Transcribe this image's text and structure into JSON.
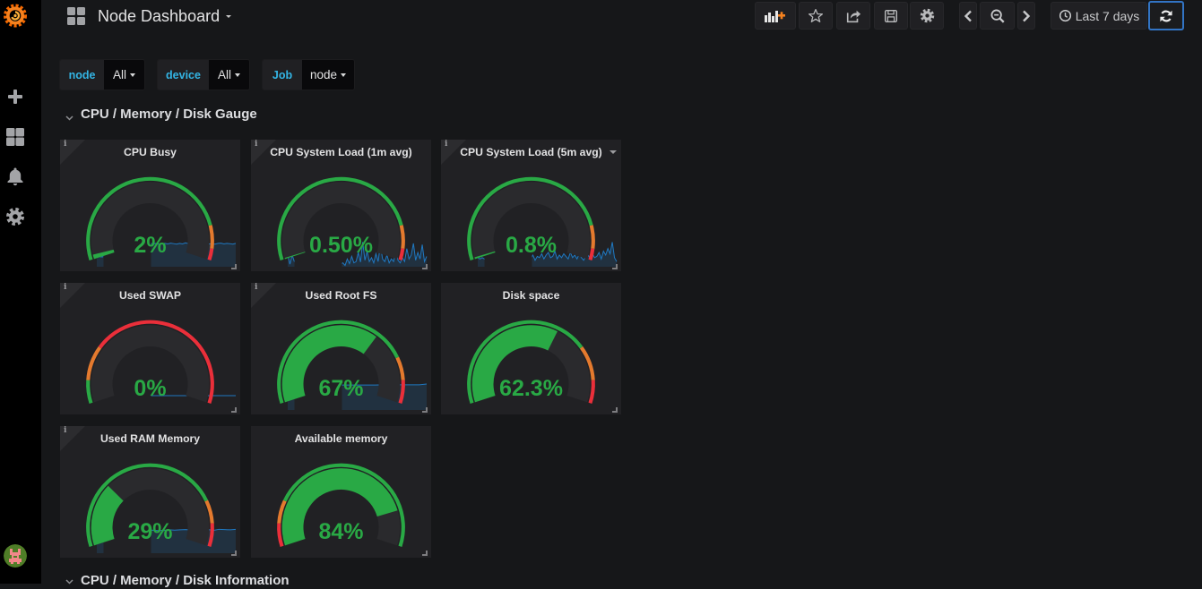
{
  "sidebar": {
    "logo": "grafana-logo",
    "items": [
      {
        "name": "create",
        "icon": "plus-icon"
      },
      {
        "name": "dashboards",
        "icon": "dashboards-icon"
      },
      {
        "name": "alerting",
        "icon": "bell-icon"
      },
      {
        "name": "configuration",
        "icon": "gear-icon"
      }
    ],
    "avatar": "user-avatar"
  },
  "header": {
    "title": "Node Dashboard",
    "icon": "dashboard-grid-icon"
  },
  "toolbar": {
    "buttons": [
      {
        "name": "add-panel",
        "icon": "add-panel-icon"
      },
      {
        "name": "star",
        "icon": "star-icon"
      },
      {
        "name": "share",
        "icon": "share-icon"
      },
      {
        "name": "save",
        "icon": "save-icon"
      },
      {
        "name": "settings",
        "icon": "gear-icon"
      },
      {
        "name": "time-back",
        "icon": "chevron-left-icon"
      },
      {
        "name": "zoom-out",
        "icon": "zoom-out-icon"
      },
      {
        "name": "time-forward",
        "icon": "chevron-right-icon"
      }
    ],
    "time_range": "Last 7 days",
    "refresh_icon": "refresh-icon"
  },
  "variables": [
    {
      "label": "node",
      "value": "All"
    },
    {
      "label": "device",
      "value": "All"
    },
    {
      "label": "Job",
      "value": "node"
    }
  ],
  "rows": [
    {
      "title": "CPU / Memory / Disk Gauge",
      "expanded": true
    },
    {
      "title": "CPU / Memory / Disk Information",
      "expanded": true
    }
  ],
  "icons": {
    "info_glyph": "i"
  },
  "colors": {
    "ok": "#29a945",
    "warn": "#e47a2e",
    "crit": "#ea2f3a",
    "spark_line": "#1f78c1",
    "spark_fill": "rgba(31,120,193,0.18)",
    "gauge_track": "#2a2a2d",
    "panel_bg": "#212124",
    "accent": "#33b5e5",
    "refresh_border": "#3274c4"
  },
  "panels": [
    {
      "title": "CPU Busy",
      "value_text": "2%",
      "value": 0.02,
      "thresholds": [
        0.85,
        0.95
      ],
      "threshold_colors": [
        "ok",
        "warn",
        "crit"
      ],
      "info": true,
      "menu_caret": false,
      "spark": {
        "fill": true,
        "values": [
          0.38,
          0.38,
          0.38,
          0.86,
          0.88,
          0.9,
          0.87,
          0.89,
          0.91,
          0.88,
          0.86,
          0.9,
          0.89,
          0.92,
          0.88,
          0.87,
          0.9,
          0.89,
          0.91,
          0.88,
          0.9,
          0.87,
          0.89,
          0.9,
          0.88,
          0.91,
          0.89,
          0.87,
          0.9,
          0.88,
          0.92,
          0.89,
          0.88,
          0.9,
          0.87,
          0.89,
          0.91,
          0.9,
          0.88,
          0.89,
          0.87,
          0.9,
          0.91,
          0.88,
          0.9,
          0.89,
          0.87,
          0.9
        ]
      }
    },
    {
      "title": "CPU System Load (1m avg)",
      "value_text": "0.50%",
      "value": 0.005,
      "thresholds": [
        0.85,
        0.95
      ],
      "threshold_colors": [
        "ok",
        "warn",
        "crit"
      ],
      "info": true,
      "menu_caret": false,
      "spark": {
        "fill": true,
        "values": [
          0.5,
          0.1,
          0.45,
          0.2,
          0.15,
          0.2,
          0.1,
          0.15,
          0.2,
          0.1,
          0.15,
          0.2,
          0.1,
          0.15,
          0.2,
          0.1,
          0.15,
          0.2,
          0.1,
          0.15,
          0.2,
          0.1,
          0.15,
          0.2,
          0.1,
          0.15,
          0.05,
          0.3,
          0.12,
          0.4,
          0.15,
          0.2,
          0.55,
          0.18,
          0.95,
          0.25,
          0.6,
          0.2,
          0.35,
          0.15,
          0.5,
          0.2,
          0.85,
          0.3,
          0.2,
          0.45,
          0.15,
          0.3,
          0.2,
          0.6,
          0.25,
          0.15,
          0.35,
          0.2,
          0.7,
          0.3,
          0.45,
          0.9,
          0.25,
          0.55,
          0.3,
          0.85,
          0.2,
          0.4
        ]
      }
    },
    {
      "title": "CPU System Load (5m avg)",
      "value_text": "0.8%",
      "value": 0.008,
      "thresholds": [
        0.85,
        0.95
      ],
      "threshold_colors": [
        "ok",
        "warn",
        "crit"
      ],
      "info": true,
      "menu_caret": true,
      "spark": {
        "fill": true,
        "values": [
          0.35,
          0.3,
          0.35,
          0.3,
          0.35,
          0.3,
          0.35,
          0.3,
          0.35,
          0.3,
          0.35,
          0.3,
          0.35,
          0.3,
          0.35,
          0.3,
          0.35,
          0.3,
          0.35,
          0.3,
          0.35,
          0.3,
          0.35,
          0.3,
          0.3,
          0.45,
          0.25,
          0.4,
          0.35,
          0.5,
          0.3,
          0.45,
          0.55,
          0.35,
          0.4,
          0.6,
          0.3,
          0.45,
          0.35,
          0.5,
          0.4,
          0.3,
          0.55,
          0.35,
          0.45,
          0.3,
          0.5,
          0.35,
          0.25,
          0.4,
          0.45,
          0.3,
          0.5,
          0.35,
          0.4,
          0.55,
          0.3,
          0.6,
          0.45,
          0.7,
          0.5,
          0.95,
          0.35,
          0.2
        ]
      }
    },
    {
      "title": "Used SWAP",
      "value_text": "0%",
      "value": 0,
      "thresholds": [
        0.1,
        0.25
      ],
      "threshold_colors": [
        "ok",
        "warn",
        "crit"
      ],
      "info": true,
      "menu_caret": false,
      "spark": {
        "fill": false,
        "values": [
          0.55,
          0.55,
          0.55,
          0.55,
          0.55,
          0.55
        ]
      }
    },
    {
      "title": "Used Root FS",
      "value_text": "67%",
      "value": 0.67,
      "thresholds": [
        0.8,
        0.9
      ],
      "threshold_colors": [
        "ok",
        "warn",
        "crit"
      ],
      "info": true,
      "menu_caret": false,
      "spark": {
        "fill": true,
        "values": [
          0.95,
          0.95,
          0.95,
          0.95,
          0.95,
          0.95,
          0.95,
          0.96,
          0.96,
          0.96,
          0.96,
          0.96,
          0.96,
          0.97,
          0.97,
          0.97,
          0.97,
          0.97,
          0.97,
          1.0
        ]
      }
    },
    {
      "title": "Disk space",
      "value_text": "62.3%",
      "value": 0.623,
      "thresholds": [
        0.75,
        0.9
      ],
      "threshold_colors": [
        "ok",
        "warn",
        "crit"
      ],
      "info": false,
      "menu_caret": false,
      "spark": null
    },
    {
      "title": "Used RAM Memory",
      "value_text": "29%",
      "value": 0.29,
      "thresholds": [
        0.8,
        0.9
      ],
      "threshold_colors": [
        "ok",
        "warn",
        "crit"
      ],
      "info": true,
      "menu_caret": false,
      "spark": {
        "fill": true,
        "values": [
          0.82,
          0.82,
          0.84,
          0.86,
          0.87,
          0.86,
          0.88,
          0.87,
          0.86,
          0.88,
          0.89,
          0.87,
          0.88,
          0.9,
          0.89,
          0.9,
          0.91,
          0.89,
          0.92,
          0.9,
          0.91,
          0.88,
          0.92,
          0.91,
          0.9,
          0.92
        ]
      }
    },
    {
      "title": "Available memory",
      "value_text": "84%",
      "value": 0.84,
      "thresholds": [
        0.1,
        0.2
      ],
      "threshold_colors": [
        "crit",
        "warn",
        "ok"
      ],
      "info": false,
      "menu_caret": false,
      "spark": null
    }
  ]
}
